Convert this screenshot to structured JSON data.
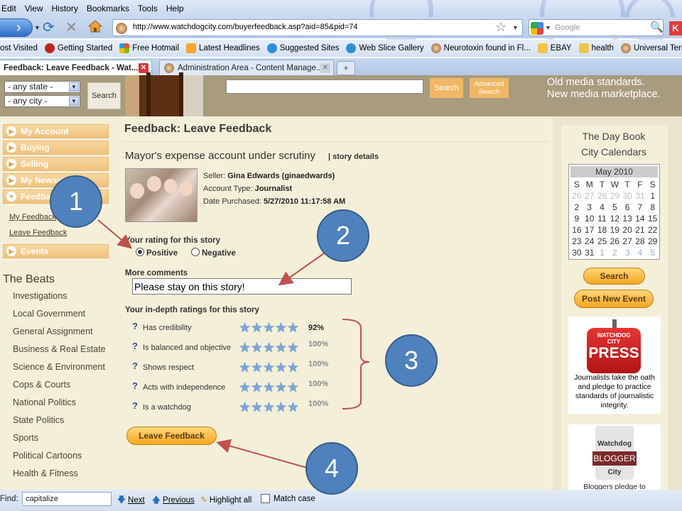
{
  "browser": {
    "menu": [
      "Edit",
      "View",
      "History",
      "Bookmarks",
      "Tools",
      "Help"
    ],
    "url": "http://www.watchdogcity.com/buyerfeedback.asp?aid=85&pid=74",
    "search_placeholder": "Google",
    "bookmarks": [
      "ost Visited",
      "Getting Started",
      "Free Hotmail",
      "Latest Headlines",
      "Suggested Sites",
      "Web Slice Gallery",
      "Neurotoxin found in Fl...",
      "EBAY",
      "health",
      "Universal Terms of Se..."
    ],
    "tabs": [
      {
        "label": "Feedback: Leave Feedback - Wat...",
        "active": true
      },
      {
        "label": "Administration Area - Content Manage...",
        "active": false
      }
    ],
    "new_tab": "+"
  },
  "header": {
    "state_select": "- any state -",
    "city_select": "- any city -",
    "search_button": "Search",
    "search2_button": "Search",
    "advanced_search": "Advanced Search",
    "tagline_1": "Old media standards.",
    "tagline_2": "New media marketplace."
  },
  "sidebar": {
    "nav": [
      "My Account",
      "Buying",
      "Selling",
      "My Newsst",
      "Feedba",
      "Events"
    ],
    "sublinks": [
      "My Feedback",
      "Leave Feedback"
    ],
    "beats_title": "The Beats",
    "beats": [
      "Investigations",
      "Local Government",
      "General Assignment",
      "Business & Real Estate",
      "Science & Environment",
      "Cops & Courts",
      "National Politics",
      "State Politics",
      "Sports",
      "Political Cartoons",
      "Health & Fitness"
    ]
  },
  "main": {
    "page_title": "Feedback: Leave Feedback",
    "story_title": "Mayor's expense account under scrutiny",
    "story_details_sep": "|",
    "story_details": "story details",
    "seller_label": "Seller:",
    "seller_value": "Gina Edwards (ginaedwards)",
    "account_label": "Account Type:",
    "account_value": "Journalist",
    "date_label": "Date Purchased:",
    "date_value": "5/27/2010 11:17:58 AM",
    "rating_label": "Your rating for this story",
    "rating_positive": "Positive",
    "rating_negative": "Negative",
    "rating_selected": "Positive",
    "comments_label": "More comments",
    "comments_value": "Please stay on this story!",
    "indepth_label": "Your in-depth ratings for this story",
    "criteria": [
      {
        "label": "Has credibility",
        "pct": "92%",
        "stars": 5
      },
      {
        "label": "Is balanced and objective",
        "pct": "100%",
        "stars": 5
      },
      {
        "label": "Shows respect",
        "pct": "100%",
        "stars": 5
      },
      {
        "label": "Acts with independence",
        "pct": "100%",
        "stars": 5
      },
      {
        "label": "Is a watchdog",
        "pct": "100%",
        "stars": 5
      }
    ],
    "help_icon": "?",
    "leave_button": "Leave Feedback"
  },
  "right": {
    "daybook": "The Day Book",
    "city_calendars": "City Calendars",
    "calendar_month": "May 2010",
    "weekdays": [
      "S",
      "M",
      "T",
      "W",
      "T",
      "F",
      "S"
    ],
    "weeks": [
      [
        "26",
        "27",
        "28",
        "29",
        "30",
        "31",
        "1"
      ],
      [
        "2",
        "3",
        "4",
        "5",
        "6",
        "7",
        "8"
      ],
      [
        "9",
        "10",
        "11",
        "12",
        "13",
        "14",
        "15"
      ],
      [
        "16",
        "17",
        "18",
        "19",
        "20",
        "21",
        "22"
      ],
      [
        "23",
        "24",
        "25",
        "26",
        "27",
        "28",
        "29"
      ],
      [
        "30",
        "31",
        "1",
        "2",
        "3",
        "4",
        "5"
      ]
    ],
    "search_button": "Search",
    "post_event_button": "Post New Event",
    "press_brand_1": "WATCHDOG",
    "press_brand_2": "CITY",
    "press_brand_3": "PRESS",
    "press_text": "Journalists take the oath and pledge to practice standards of journalistic integrity.",
    "blogger_1": "Watchdog",
    "blogger_2": "BLOGGER",
    "blogger_3": "City",
    "blogger_text": "Bloggers pledge to"
  },
  "findbar": {
    "label": "Find:",
    "value": "capitalize",
    "next": "Next",
    "previous": "Previous",
    "highlight": "Highlight all",
    "match_case": "Match case"
  },
  "annotations": [
    "1",
    "2",
    "3",
    "4"
  ],
  "colors": {
    "accent_orange": "#f0b865",
    "callout_blue": "#4f81bd",
    "arrow_red": "#c0504d"
  }
}
